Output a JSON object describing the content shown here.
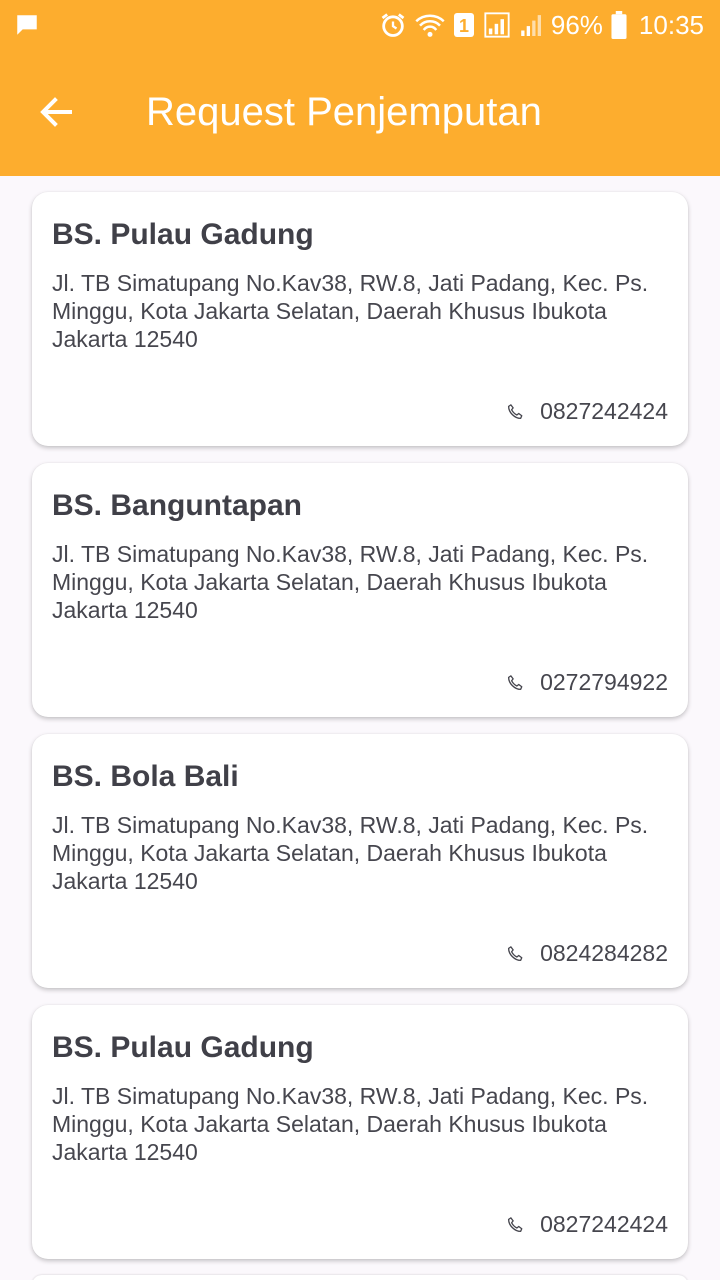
{
  "status_bar": {
    "battery": "96%",
    "time": "10:35",
    "sim_badge": "1",
    "icons": [
      "chat-icon",
      "alarm-icon",
      "wifi-icon",
      "signal-icon",
      "battery-icon"
    ]
  },
  "app_bar": {
    "title": "Request Penjemputan",
    "back_icon": "arrow-left-icon",
    "color": "#fdad2e"
  },
  "banks": [
    {
      "name": "BS. Pulau Gadung",
      "address": "Jl. TB Simatupang No.Kav38, RW.8, Jati Padang, Kec. Ps. Minggu, Kota Jakarta Selatan, Daerah Khusus Ibukota Jakarta 12540",
      "phone": "0827242424"
    },
    {
      "name": "BS. Banguntapan",
      "address": "Jl. TB Simatupang No.Kav38, RW.8, Jati Padang, Kec. Ps. Minggu, Kota Jakarta Selatan, Daerah Khusus Ibukota Jakarta 12540",
      "phone": "0272794922"
    },
    {
      "name": "BS. Bola Bali",
      "address": "Jl. TB Simatupang No.Kav38, RW.8, Jati Padang, Kec. Ps. Minggu, Kota Jakarta Selatan, Daerah Khusus Ibukota Jakarta 12540",
      "phone": "0824284282"
    },
    {
      "name": "BS. Pulau Gadung",
      "address": "Jl. TB Simatupang No.Kav38, RW.8, Jati Padang, Kec. Ps. Minggu, Kota Jakarta Selatan, Daerah Khusus Ibukota Jakarta 12540",
      "phone": "0827242424"
    }
  ]
}
